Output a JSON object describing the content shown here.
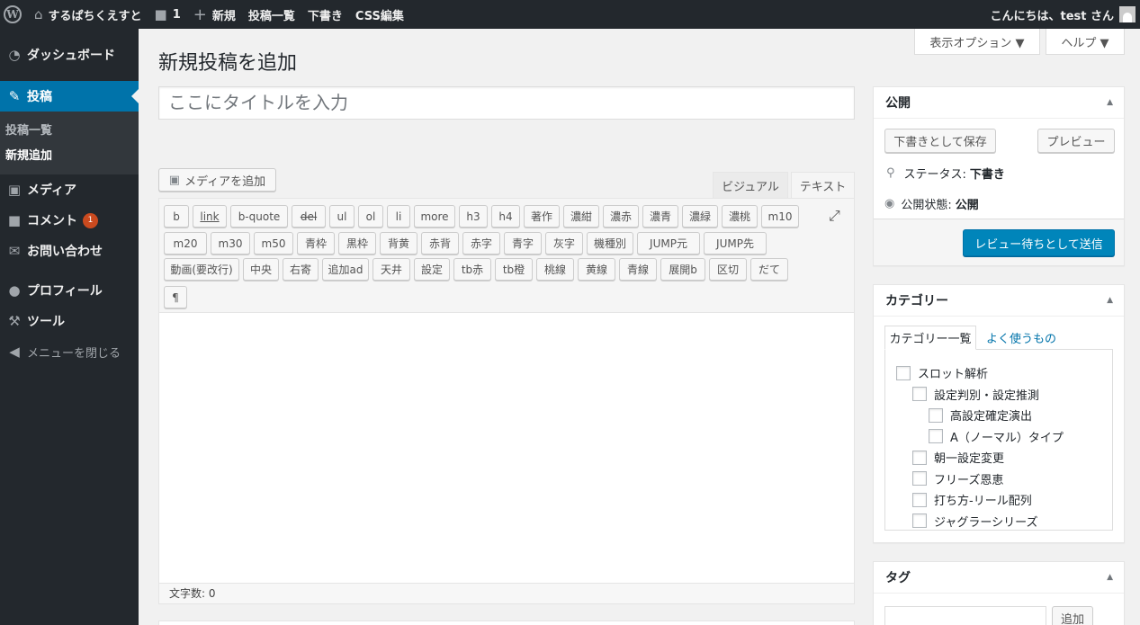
{
  "adminbar": {
    "site_name": "するぱちくえすと",
    "comments_count": "1",
    "new_label": "新規",
    "posts_list": "投稿一覧",
    "drafts": "下書き",
    "css_edit": "CSS編集",
    "greeting": "こんにちは、test さん"
  },
  "sidebar": {
    "dashboard": "ダッシュボード",
    "posts": "投稿",
    "sub_posts_list": "投稿一覧",
    "sub_new": "新規追加",
    "media": "メディア",
    "comments": "コメント",
    "comments_badge": "1",
    "contact": "お問い合わせ",
    "profile": "プロフィール",
    "tools": "ツール",
    "collapse": "メニューを閉じる"
  },
  "screen_options": "表示オプション ▼",
  "help": "ヘルプ ▼",
  "page_title": "新規投稿を追加",
  "title_placeholder": "ここにタイトルを入力",
  "editor": {
    "add_media": "メディアを追加",
    "tab_visual": "ビジュアル",
    "tab_text": "テキスト",
    "word_count": "文字数: 0",
    "quicktags_row1": [
      "b",
      "link",
      "b-quote",
      "del",
      "ul",
      "ol",
      "li",
      "more",
      "h3",
      "h4",
      "著作",
      "濃紺",
      "濃赤",
      "濃青",
      "濃緑",
      "濃桃",
      "m10"
    ],
    "quicktags_row2": [
      "m20",
      "m30",
      "m50",
      "青枠",
      "黒枠",
      "背黄",
      "赤背",
      "赤字",
      "青字",
      "灰字",
      "機種別",
      "JUMP元",
      "JUMP先"
    ],
    "quicktags_row3": [
      "動画(要改行)",
      "中央",
      "右寄",
      "追加ad",
      "天井",
      "設定",
      "tb赤",
      "tb橙",
      "桃線",
      "黄線",
      "青線",
      "展開b",
      "区切",
      "だて"
    ],
    "quicktags_row4": [
      "¶"
    ]
  },
  "publish": {
    "title": "公開",
    "save_draft": "下書きとして保存",
    "preview": "プレビュー",
    "status_label": "ステータス:",
    "status_value": "下書き",
    "visibility_label": "公開状態:",
    "visibility_value": "公開",
    "submit": "レビュー待ちとして送信"
  },
  "categories": {
    "title": "カテゴリー",
    "tab_all": "カテゴリー一覧",
    "tab_popular": "よく使うもの",
    "items": [
      "スロット解析",
      "設定判別・設定推測",
      "高設定確定演出",
      "A（ノーマル）タイプ",
      "朝一設定変更",
      "フリーズ恩恵",
      "打ち方-リール配列",
      "ジャグラーシリーズ"
    ]
  },
  "tags": {
    "title": "タグ",
    "add": "追加"
  },
  "colors": {
    "adminbar_bg": "#23282d",
    "accent": "#0073aa",
    "badge": "#ca4a1f"
  }
}
